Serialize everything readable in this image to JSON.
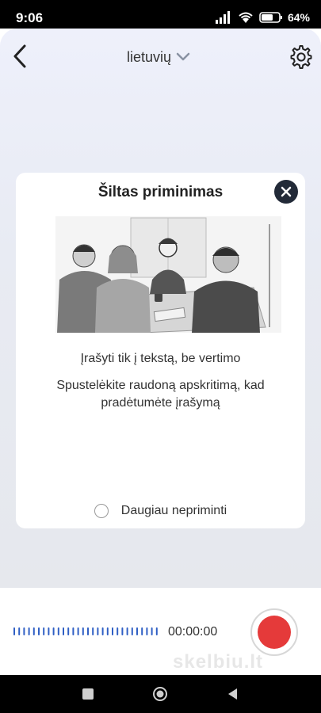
{
  "status_bar": {
    "time": "9:06",
    "battery": "64%"
  },
  "header": {
    "language": "lietuvių"
  },
  "dialog": {
    "title": "Šiltas priminimas",
    "line1": "Įrašyti tik į tekstą, be vertimo",
    "line2": "Spustelėkite raudoną apskritimą, kad pradėtumėte įrašymą",
    "dont_remind": "Daugiau nepriminti"
  },
  "recorder": {
    "timer": "00:00:00",
    "accent": "#e53a3a",
    "wave_color": "#2f5fc4"
  },
  "watermark": "skelbiu.lt"
}
